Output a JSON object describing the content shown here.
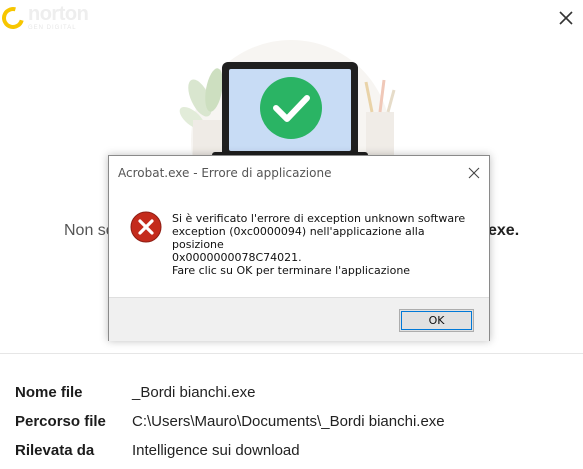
{
  "header": {
    "brand": "norton",
    "brand_sub": "GEN DIGITAL"
  },
  "background_message": {
    "prefix": "Non so",
    "suffix": "exe."
  },
  "details": [
    {
      "label": "Nome file",
      "value": "_Bordi bianchi.exe"
    },
    {
      "label": "Percorso file",
      "value": "C:\\Users\\Mauro\\Documents\\_Bordi bianchi.exe"
    },
    {
      "label": "Rilevata da",
      "value": "Intelligence sui download"
    }
  ],
  "dialog": {
    "title": "Acrobat.exe - Errore di applicazione",
    "message_line1": "Si è verificato l'errore di exception unknown software",
    "message_line2": "exception (0xc0000094) nell'applicazione alla posizione",
    "message_line3": "0x0000000078C74021.",
    "message_2": "Fare clic su OK per terminare l'applicazione",
    "ok_label": "OK"
  },
  "colors": {
    "norton_yellow": "#f7c600",
    "check_green": "#2ab464",
    "error_red": "#c42b1c",
    "focus_blue": "#0078d7"
  }
}
